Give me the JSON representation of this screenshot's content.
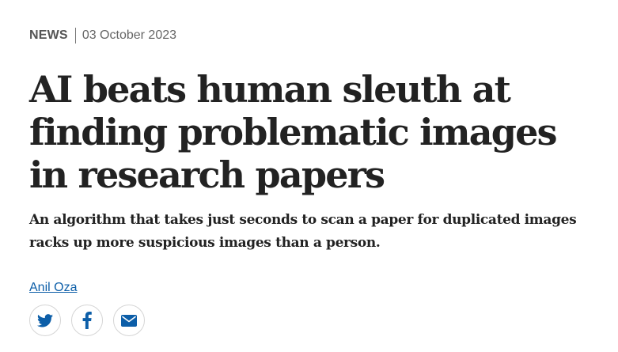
{
  "article": {
    "category": "NEWS",
    "date": "03 October 2023",
    "title": "AI beats human sleuth at finding problematic images in research papers",
    "standfirst": "An algorithm that takes just seconds to scan a paper for duplicated images racks up more suspicious images than a person.",
    "author": "Anil Oza"
  },
  "share": {
    "icons": [
      "twitter-icon",
      "facebook-icon",
      "email-icon"
    ]
  },
  "colors": {
    "text": "#222222",
    "author_link": "#0c5ea8",
    "icon": "#0c5ea8",
    "border": "#d5d5d5"
  }
}
